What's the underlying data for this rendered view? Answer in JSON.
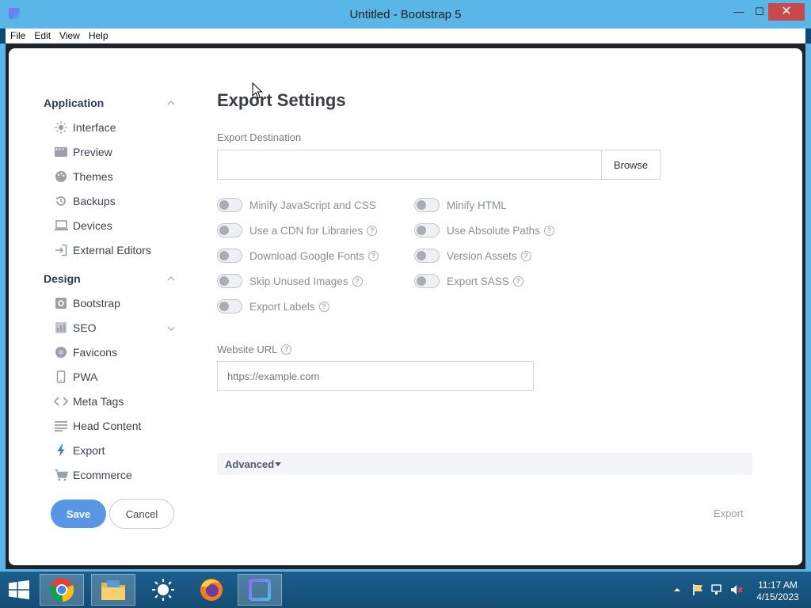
{
  "window": {
    "title": "Untitled - Bootstrap 5",
    "minimize": "—",
    "maximize": "☐",
    "close": "✕"
  },
  "menu": [
    "File",
    "Edit",
    "View",
    "Help"
  ],
  "sidebar": {
    "sections": [
      {
        "title": "Application",
        "items": [
          {
            "label": "Interface",
            "icon": "sun-icon"
          },
          {
            "label": "Preview",
            "icon": "film-icon"
          },
          {
            "label": "Themes",
            "icon": "palette-icon"
          },
          {
            "label": "Backups",
            "icon": "history-icon"
          },
          {
            "label": "Devices",
            "icon": "laptop-icon"
          },
          {
            "label": "External Editors",
            "icon": "sign-in-icon"
          }
        ]
      },
      {
        "title": "Design",
        "items": [
          {
            "label": "Bootstrap",
            "icon": "gear-icon"
          },
          {
            "label": "SEO",
            "icon": "chart-icon"
          },
          {
            "label": "Favicons",
            "icon": "circle-icon"
          },
          {
            "label": "PWA",
            "icon": "mobile-icon"
          },
          {
            "label": "Meta Tags",
            "icon": "code-icon"
          },
          {
            "label": "Head Content",
            "icon": "align-icon"
          },
          {
            "label": "Export",
            "icon": "bolt-icon"
          },
          {
            "label": "Ecommerce",
            "icon": "cart-icon"
          }
        ]
      }
    ],
    "save": "Save",
    "cancel": "Cancel"
  },
  "main": {
    "title": "Export Settings",
    "destination_label": "Export Destination",
    "destination_value": "",
    "browse": "Browse",
    "options_left": [
      {
        "label": "Minify JavaScript and CSS",
        "help": false,
        "on": false
      },
      {
        "label": "Use a CDN for Libraries",
        "help": true,
        "on": false
      },
      {
        "label": "Download Google Fonts",
        "help": true,
        "on": false
      },
      {
        "label": "Skip Unused Images",
        "help": true,
        "on": false
      },
      {
        "label": "Export Labels",
        "help": true,
        "on": false
      }
    ],
    "options_right": [
      {
        "label": "Minify HTML",
        "help": false,
        "on": false
      },
      {
        "label": "Use Absolute Paths",
        "help": true,
        "on": false
      },
      {
        "label": "Version Assets",
        "help": true,
        "on": false
      },
      {
        "label": "Export SASS",
        "help": true,
        "on": false
      }
    ],
    "help_glyph": "?",
    "website_url_label": "Website URL",
    "website_url_placeholder": "https://example.com",
    "advanced": "Advanced",
    "export": "Export"
  },
  "taskbar": {
    "apps": [
      "start-icon",
      "chrome-icon",
      "file-explorer-icon",
      "weather-icon",
      "firefox-icon",
      "bootstrap-studio-icon"
    ],
    "time": "11:17 AM",
    "date": "4/15/2023"
  },
  "colors": {
    "titlebar": "#5ab6e6",
    "accent": "#5797e6",
    "close": "#c94a4a"
  }
}
